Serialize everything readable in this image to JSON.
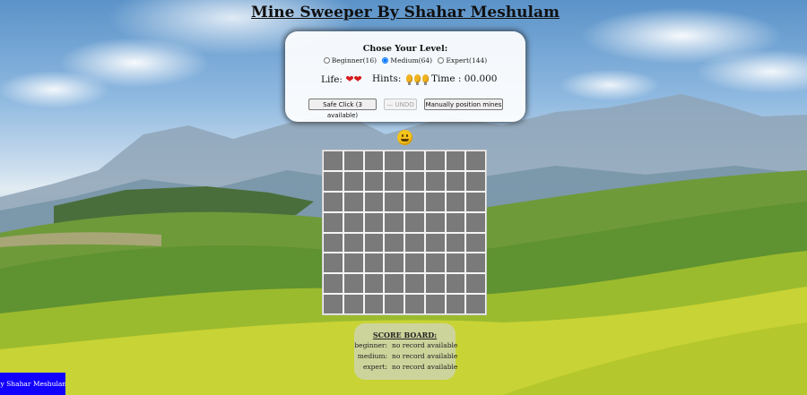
{
  "header": {
    "title": "Mine Sweeper By Shahar Meshulam"
  },
  "controls": {
    "levels_title": "Chose Your Level:",
    "levels": [
      {
        "label": "Beginner(16)",
        "selected": false
      },
      {
        "label": "Medium(64)",
        "selected": true
      },
      {
        "label": "Expert(144)",
        "selected": false
      }
    ],
    "life_label": "Life:",
    "life_count": 2,
    "hints_label": "Hints:",
    "hints_count": 3,
    "time_label": "Time : 00.000",
    "safe_click_label": "Safe Click (3 available)",
    "undo_label": "UNDO",
    "manual_label": "Manually position mines"
  },
  "board": {
    "rows": 8,
    "cols": 8,
    "face_icon": "smiley-face-icon"
  },
  "scoreboard": {
    "title": "SCORE BOARD:",
    "rows": [
      {
        "level": "beginner:",
        "value": "no record available"
      },
      {
        "level": "medium:",
        "value": "no record available"
      },
      {
        "level": "expert:",
        "value": "no record available"
      }
    ]
  },
  "footer": {
    "text": "By Shahar Meshulam"
  },
  "colors": {
    "footer_bg": "#1100ff",
    "cell": "#7a7a7a",
    "heart": "#d61a1a",
    "bulb": "#f0b31e"
  }
}
